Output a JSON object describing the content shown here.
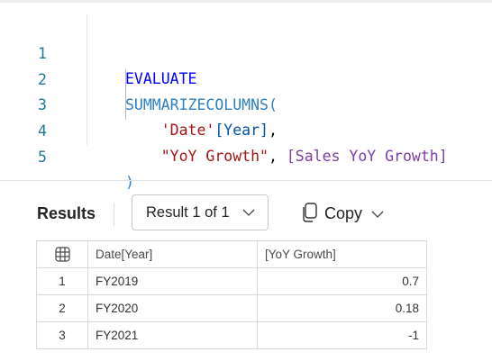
{
  "editor": {
    "lines": [
      {
        "num": "1",
        "tokens": [
          {
            "t": "EVALUATE",
            "c": "kw"
          }
        ]
      },
      {
        "num": "2",
        "tokens": [
          {
            "t": "SUMMARIZECOLUMNS(",
            "c": "fn"
          }
        ]
      },
      {
        "num": "3",
        "tokens": [
          {
            "t": "    "
          },
          {
            "t": "'Date'",
            "c": "tbl"
          },
          {
            "t": "[Year]",
            "c": "col"
          },
          {
            "t": ",",
            "c": "punc"
          }
        ]
      },
      {
        "num": "4",
        "tokens": [
          {
            "t": "    "
          },
          {
            "t": "\"YoY Growth\"",
            "c": "str"
          },
          {
            "t": ", ",
            "c": "punc"
          },
          {
            "t": "[Sales YoY Growth]",
            "c": "meas"
          }
        ]
      },
      {
        "num": "5",
        "tokens": [
          {
            "t": ")",
            "c": "paren"
          }
        ]
      }
    ]
  },
  "results": {
    "title": "Results",
    "result_selector": "Result 1 of 1",
    "copy_label": "Copy",
    "table": {
      "columns": [
        "Date[Year]",
        "[YoY Growth]"
      ],
      "rows": [
        {
          "index": "1",
          "year": "FY2019",
          "value": "0.7"
        },
        {
          "index": "2",
          "year": "FY2020",
          "value": "0.18"
        },
        {
          "index": "3",
          "year": "FY2021",
          "value": "-1"
        }
      ]
    }
  },
  "icons": {
    "grid_header": "table-grid-icon",
    "dropdown": "chevron-down-icon",
    "copy": "copy-icon"
  },
  "colors": {
    "keyword": "#0000ff",
    "function": "#2f7fc1",
    "string": "#a31515",
    "column": "#0451a5",
    "measure": "#7b3ea5",
    "line_number": "#237893"
  }
}
